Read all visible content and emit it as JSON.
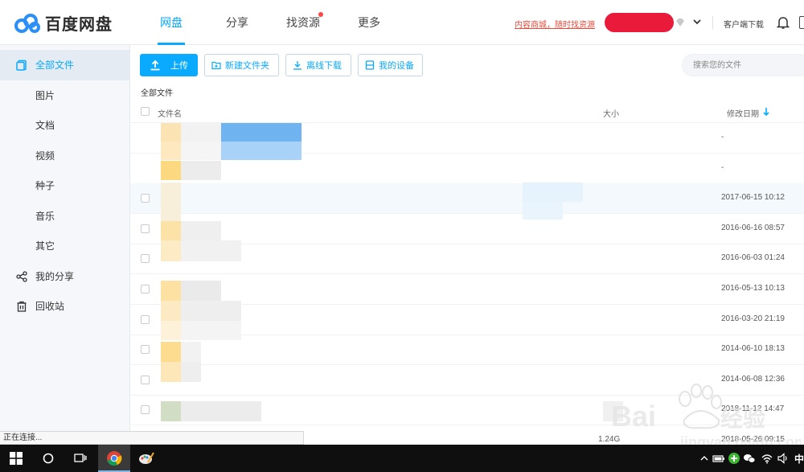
{
  "app": {
    "logo_text": "百度网盘",
    "brand_color": "#09aaff"
  },
  "nav": {
    "items": [
      {
        "label": "网盘",
        "active": true
      },
      {
        "label": "分享",
        "active": false
      },
      {
        "label": "找资源",
        "active": false,
        "has_dot": true
      },
      {
        "label": "更多",
        "active": false
      }
    ]
  },
  "header": {
    "promo_link": "内容商城，随时找资源",
    "client_download": "客户端下载"
  },
  "sidebar": {
    "items": [
      {
        "label": "全部文件",
        "icon": "all-files-icon",
        "active": true
      },
      {
        "label": "图片"
      },
      {
        "label": "文档"
      },
      {
        "label": "视频"
      },
      {
        "label": "种子"
      },
      {
        "label": "音乐"
      },
      {
        "label": "其它"
      },
      {
        "label": "我的分享",
        "icon": "share-icon"
      },
      {
        "label": "回收站",
        "icon": "trash-icon"
      }
    ]
  },
  "toolbar": {
    "upload": "上传",
    "new_folder": "新建文件夹",
    "offline_download": "离线下载",
    "my_devices": "我的设备"
  },
  "search": {
    "placeholder": "搜索您的文件"
  },
  "breadcrumb": "全部文件",
  "table": {
    "columns": {
      "name": "文件名",
      "size": "大小",
      "date": "修改日期"
    },
    "rows": [
      {
        "checkbox": false,
        "size": "",
        "date": "-"
      },
      {
        "checkbox": false,
        "size": "",
        "date": "-"
      },
      {
        "checkbox": true,
        "size": "",
        "date": "2017-06-15 10:12",
        "hover": true
      },
      {
        "checkbox": true,
        "size": "",
        "date": "2016-06-16 08:57"
      },
      {
        "checkbox": true,
        "size": "",
        "date": "2016-06-03 01:24"
      },
      {
        "checkbox": true,
        "size": "",
        "date": "2016-05-13 10:13"
      },
      {
        "checkbox": true,
        "size": "",
        "date": "2016-03-20 21:19"
      },
      {
        "checkbox": true,
        "size": "",
        "date": "2014-06-10 18:13"
      },
      {
        "checkbox": true,
        "size": "",
        "date": "2014-06-08 12:36"
      },
      {
        "checkbox": true,
        "size": "",
        "date": "2018-11-12 14:47"
      },
      {
        "checkbox": false,
        "size": "1.24G",
        "date": "2018-05-26 09:15"
      }
    ]
  },
  "status_bar": "正在连接...",
  "taskbar": {
    "ime": "中"
  }
}
